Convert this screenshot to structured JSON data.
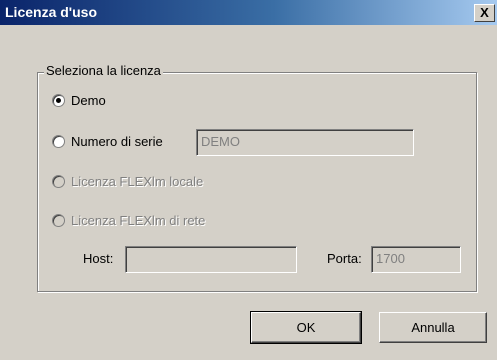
{
  "window": {
    "title": "Licenza d'uso",
    "close_label": "X"
  },
  "group": {
    "legend": "Seleziona la licenza"
  },
  "options": {
    "demo": {
      "label": "Demo",
      "selected": true,
      "enabled": true
    },
    "serial": {
      "label": "Numero di serie",
      "selected": false,
      "enabled": true,
      "value": "DEMO"
    },
    "flex_local": {
      "label": "Licenza FLEXlm locale",
      "selected": false,
      "enabled": false
    },
    "flex_net": {
      "label": "Licenza FLEXlm di rete",
      "selected": false,
      "enabled": false
    }
  },
  "network": {
    "host_label": "Host:",
    "host_value": "",
    "port_label": "Porta:",
    "port_value": "1700"
  },
  "buttons": {
    "ok": "OK",
    "cancel": "Annulla"
  }
}
